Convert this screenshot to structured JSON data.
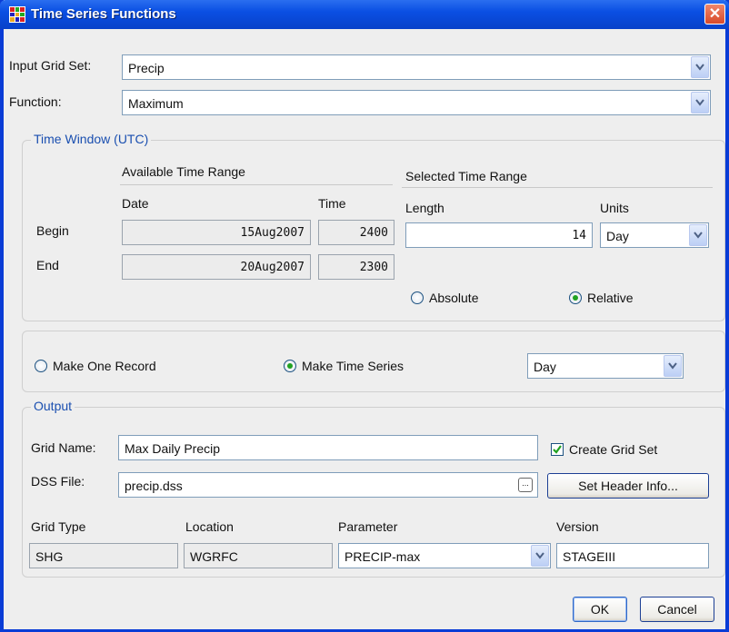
{
  "window": {
    "title": "Time Series Functions",
    "close_glyph": "✕"
  },
  "input_grid_set": {
    "label": "Input Grid Set:",
    "value": "Precip"
  },
  "function": {
    "label": "Function:",
    "value": "Maximum"
  },
  "time_window": {
    "title": "Time Window (UTC)",
    "available": {
      "heading": "Available Time Range",
      "date_header": "Date",
      "time_header": "Time",
      "begin_label": "Begin",
      "end_label": "End",
      "begin_date": "15Aug2007",
      "begin_time": "2400",
      "end_date": "20Aug2007",
      "end_time": "2300"
    },
    "selected": {
      "heading": "Selected Time Range",
      "length_label": "Length",
      "units_label": "Units",
      "length_value": "14",
      "units_value": "Day",
      "absolute_label": "Absolute",
      "relative_label": "Relative",
      "selected_mode": "Relative"
    }
  },
  "record_mode": {
    "one_record_label": "Make One Record",
    "time_series_label": "Make Time Series",
    "selected": "Make Time Series",
    "interval_value": "Day"
  },
  "output": {
    "title": "Output",
    "grid_name_label": "Grid Name:",
    "grid_name_value": "Max Daily Precip",
    "create_grid_set_label": "Create Grid Set",
    "create_grid_set_checked": true,
    "dss_file_label": "DSS File:",
    "dss_file_value": "precip.dss",
    "browse_label": "...",
    "set_header_label": "Set Header Info...",
    "grid_type_label": "Grid Type",
    "location_label": "Location",
    "parameter_label": "Parameter",
    "version_label": "Version",
    "grid_type_value": "SHG",
    "location_value": "WGRFC",
    "parameter_value": "PRECIP-max",
    "version_value": "STAGEIII"
  },
  "buttons": {
    "ok": "OK",
    "cancel": "Cancel"
  },
  "colors": {
    "titlebar": "#0a4fe3",
    "group_title": "#1a4fb0",
    "radio_selected": "#21a121",
    "checkbox_check": "#21a121"
  }
}
